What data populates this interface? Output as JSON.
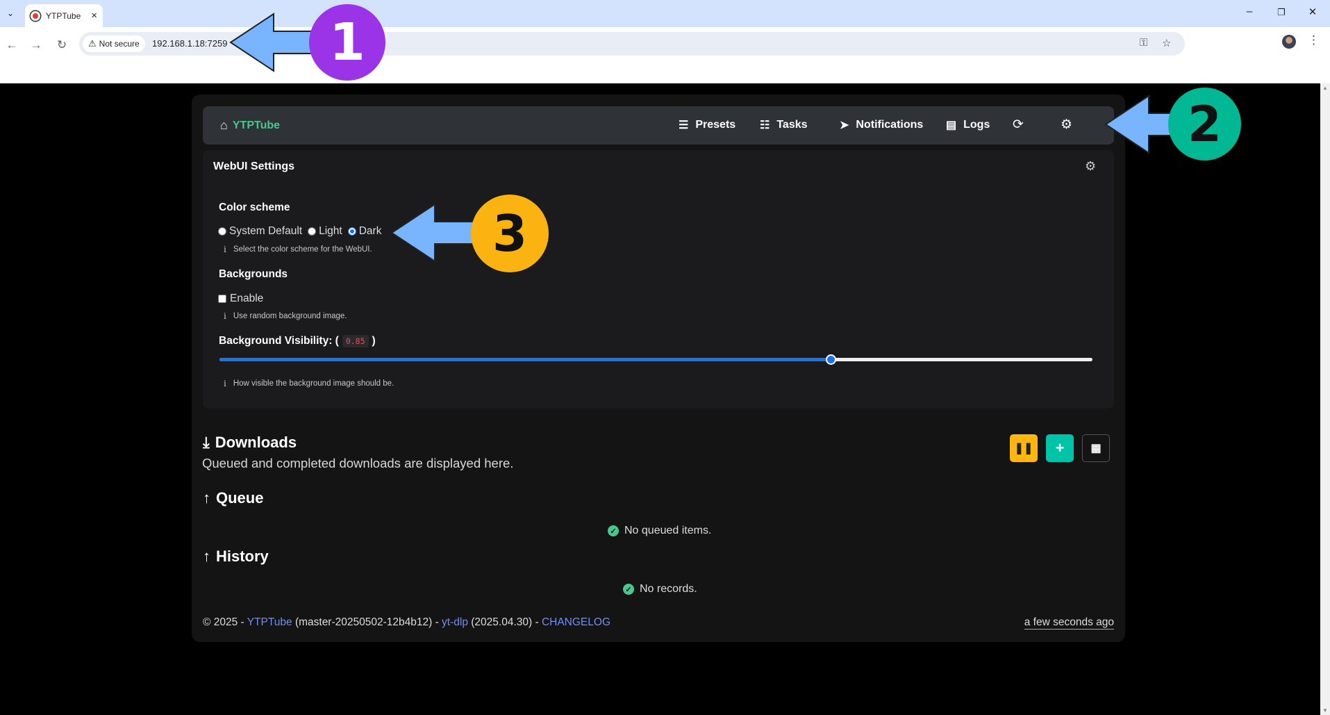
{
  "browser": {
    "tab_title": "YTPTube",
    "security_label": "Not secure",
    "url": "192.168.1.18:7259"
  },
  "app": {
    "brand": "YTPTube",
    "nav": {
      "presets": "Presets",
      "tasks": "Tasks",
      "notifications": "Notifications",
      "logs": "Logs"
    },
    "settings": {
      "title": "WebUI Settings",
      "color_scheme_label": "Color scheme",
      "color_scheme_options": [
        "System Default",
        "Light",
        "Dark"
      ],
      "color_scheme_selected": "Dark",
      "color_scheme_help": "Select the color scheme for the WebUI.",
      "backgrounds_label": "Backgrounds",
      "enable_label": "Enable",
      "enable_checked": false,
      "backgrounds_help": "Use random background image.",
      "visibility_label_prefix": "Background Visibility: (",
      "visibility_value": "0.85",
      "visibility_label_suffix": ")",
      "visibility_help": "How visible the background image should be."
    },
    "downloads": {
      "title": "Downloads",
      "subtitle": "Queued and completed downloads are displayed here.",
      "queue_title": "Queue",
      "queue_empty": "No queued items.",
      "history_title": "History",
      "history_empty": "No records."
    },
    "footer": {
      "copyright": "© 2025 -",
      "app_link": "YTPTube",
      "version": "(master-20250502-12b4b12) -",
      "ytdlp_link": "yt-dlp",
      "ytdlp_version": "(2025.04.30) -",
      "changelog_link": "CHANGELOG",
      "updated": "a few seconds ago"
    }
  },
  "annotations": [
    {
      "number": "1",
      "color": "#9b34e6"
    },
    {
      "number": "2",
      "color": "#00b894"
    },
    {
      "number": "3",
      "color": "#fbb311"
    }
  ],
  "colors": {
    "brand_green": "#48c78e",
    "arrow_blue": "#79b4ff",
    "pause_yellow": "#ffb70f",
    "add_teal": "#00c4a7",
    "link_blue": "#6e8efb",
    "code_red": "#f14668"
  }
}
